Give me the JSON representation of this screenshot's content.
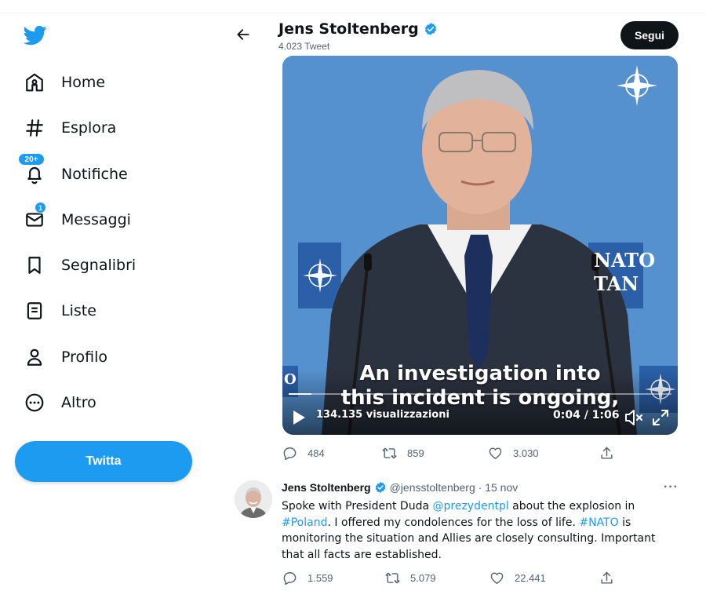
{
  "colors": {
    "accent": "#1d9bf0",
    "text": "#0f1419",
    "secondary": "#536471",
    "video_bg": "#5a96d2"
  },
  "sidebar": {
    "logo_icon": "twitter-bird-icon",
    "items": [
      {
        "label": "Home",
        "icon": "home-icon"
      },
      {
        "label": "Esplora",
        "icon": "hashtag-icon"
      },
      {
        "label": "Notifiche",
        "icon": "bell-icon",
        "badge": "20+"
      },
      {
        "label": "Messaggi",
        "icon": "envelope-icon",
        "badge": "1"
      },
      {
        "label": "Segnalibri",
        "icon": "bookmark-icon"
      },
      {
        "label": "Liste",
        "icon": "list-icon"
      },
      {
        "label": "Profilo",
        "icon": "person-icon"
      },
      {
        "label": "Altro",
        "icon": "more-circle-icon"
      }
    ],
    "tweet_button": "Twitta"
  },
  "header": {
    "name": "Jens Stoltenberg",
    "tweet_count": "4.023 Tweet",
    "follow_button": "Segui"
  },
  "video": {
    "caption_line1": "An investigation into",
    "caption_line2": "this incident is ongoing,",
    "views": "134.135 visualizzazioni",
    "time": "0:04 / 1:06",
    "progress": 0.06,
    "sign_text_1": "NATO",
    "sign_text_2": "TAN",
    "sign_text_3": "O"
  },
  "tweet1_actions": {
    "replies": "484",
    "retweets": "859",
    "likes": "3.030"
  },
  "tweet2": {
    "name": "Jens Stoltenberg",
    "handle_date": "@jensstoltenberg · 15 nov",
    "more": "···",
    "text_1": "Spoke with President Duda ",
    "mention": "@prezydentpl",
    "text_2": " about the explosion in ",
    "hashtag_1": "#Poland",
    "text_3": ". I offered my condolences for the loss of life. ",
    "hashtag_2": "#NATO",
    "text_4": " is monitoring the situation and Allies are closely consulting. Important that all facts are established."
  },
  "tweet2_actions": {
    "replies": "1.559",
    "retweets": "5.079",
    "likes": "22.441"
  }
}
